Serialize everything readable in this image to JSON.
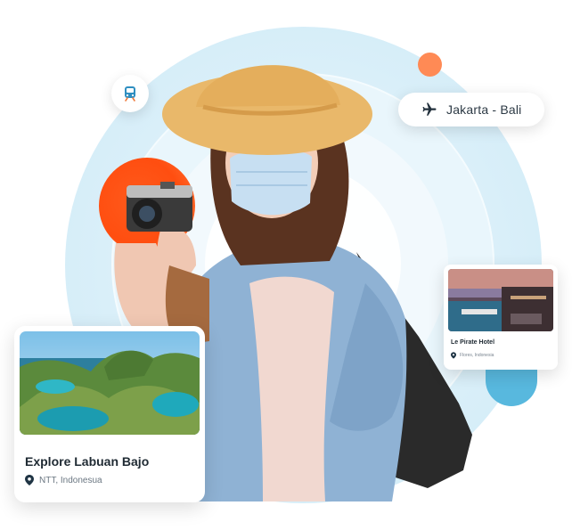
{
  "route_pill": {
    "text": "Jakarta - Bali",
    "icon": "airplane-icon"
  },
  "transport_bubble": {
    "icon": "train-icon"
  },
  "explore_card": {
    "title": "Explore Labuan Bajo",
    "location": "NTT, Indonesua",
    "icon": "location-pin-icon"
  },
  "hotel_card": {
    "title": "Le Pirate Hotel",
    "location": "Flores, Indonesia",
    "icon": "location-pin-icon"
  },
  "colors": {
    "accent_orange": "#ff4e10",
    "accent_blue": "#58b8de",
    "ring_blue": "#d9eff9",
    "text_dark": "#1f2a33"
  }
}
